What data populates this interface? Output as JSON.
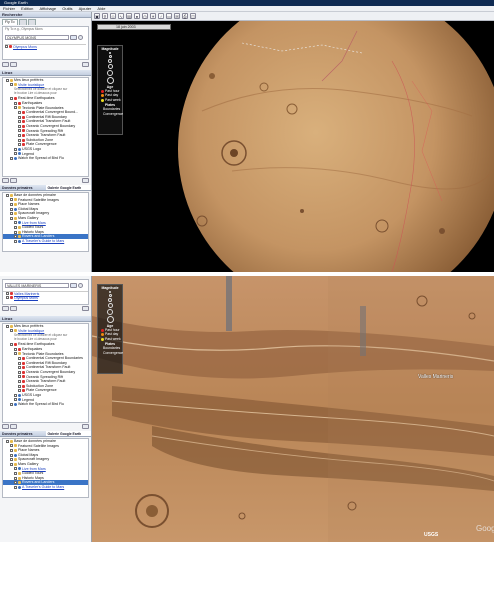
{
  "app": {
    "title": "Google Earth"
  },
  "menu": [
    "Fichier",
    "Edition",
    "Affichage",
    "Outils",
    "Ajouter",
    "Aide"
  ],
  "top": {
    "search_header": "Recherche",
    "search_tabs": [
      "Fly To",
      "",
      ""
    ],
    "fly_to_hint": "Fly To e.g., Olympus Mons",
    "search_value": "OLYMPUS MONS",
    "result": "Olympus Mons",
    "places_header": "Lieux",
    "places": [
      {
        "label": "Mes lieux préférés",
        "indent": 0,
        "icon": "folder"
      },
      {
        "label": "Visite touristique",
        "indent": 1,
        "icon": "folder",
        "link": true
      },
      {
        "label": "Sélectionnez ce dossier et cliquez sur",
        "indent": 2,
        "small": true
      },
      {
        "label": "le bouton Lire ci-dessous pour",
        "indent": 2,
        "small": true
      },
      {
        "label": "Real-time Earthquakes",
        "indent": 1,
        "icon": "red"
      },
      {
        "label": "Earthquakes",
        "indent": 2,
        "icon": "red"
      },
      {
        "label": "Tectonic Plate Boundaries",
        "indent": 2,
        "icon": "folder"
      },
      {
        "label": "Continental Convergent Bound...",
        "indent": 3,
        "icon": "red"
      },
      {
        "label": "Continental Rift Boundary",
        "indent": 3,
        "icon": "red"
      },
      {
        "label": "Continental Transform Fault",
        "indent": 3,
        "icon": "red"
      },
      {
        "label": "Oceanic Convergent Boundary",
        "indent": 3,
        "icon": "red"
      },
      {
        "label": "Oceanic Spreading Rift",
        "indent": 3,
        "icon": "red"
      },
      {
        "label": "Oceanic Transform Fault",
        "indent": 3,
        "icon": "red"
      },
      {
        "label": "Subduction Zone",
        "indent": 3,
        "icon": "red"
      },
      {
        "label": "Plate Convergence",
        "indent": 3,
        "icon": "red"
      },
      {
        "label": "USGS Logo",
        "indent": 2,
        "icon": "globe"
      },
      {
        "label": "Legend",
        "indent": 2,
        "icon": "globe"
      },
      {
        "label": "Watch the Spread of Bird Flu",
        "indent": 1,
        "icon": "globe"
      }
    ],
    "layers_header": "Données primaires",
    "layers_tab": "Galerie Google Earth",
    "layers": [
      {
        "label": "Base de données primaire",
        "indent": 0,
        "icon": "folder"
      },
      {
        "label": "Featured Satellite Images",
        "indent": 1,
        "icon": "folder"
      },
      {
        "label": "Place Names",
        "indent": 1,
        "icon": "folder"
      },
      {
        "label": "Global Maps",
        "indent": 1,
        "icon": "globe"
      },
      {
        "label": "Spacecraft Imagery",
        "indent": 1,
        "icon": "folder"
      },
      {
        "label": "Mars Gallery",
        "indent": 1,
        "icon": "folder"
      },
      {
        "label": "Live from Mars",
        "indent": 2,
        "icon": "globe",
        "link": true
      },
      {
        "label": "Guided Tours",
        "indent": 2,
        "icon": "folder"
      },
      {
        "label": "Historic Maps",
        "indent": 2,
        "icon": "folder"
      },
      {
        "label": "Rovers and Landers",
        "indent": 2,
        "icon": "folder",
        "selected": true
      },
      {
        "label": "A Traveler's Guide to Mars",
        "indent": 2,
        "icon": "globe",
        "link": true
      }
    ],
    "time_label": "18 juin 2003"
  },
  "bottom": {
    "search_value": "VALLES MARINERIS",
    "results": [
      "Valles Marineris",
      "Olympus Mons"
    ],
    "places_header": "Lieux",
    "places": [
      {
        "label": "Mes lieux préférés",
        "indent": 0,
        "icon": "folder"
      },
      {
        "label": "Visite touristique",
        "indent": 1,
        "icon": "folder",
        "link": true
      },
      {
        "label": "Sélectionnez ce dossier et cliquez sur",
        "indent": 2,
        "small": true
      },
      {
        "label": "le bouton Lire ci-dessous pour",
        "indent": 2,
        "small": true
      },
      {
        "label": "Real-time Earthquakes",
        "indent": 1,
        "icon": "red"
      },
      {
        "label": "Earthquakes",
        "indent": 2,
        "icon": "red"
      },
      {
        "label": "Tectonic Plate Boundaries",
        "indent": 2,
        "icon": "folder"
      },
      {
        "label": "Continental Convergent Boundaries",
        "indent": 3,
        "icon": "red"
      },
      {
        "label": "Continental Rift Boundary",
        "indent": 3,
        "icon": "red"
      },
      {
        "label": "Continental Transform Fault",
        "indent": 3,
        "icon": "red"
      },
      {
        "label": "Oceanic Convergent Boundary",
        "indent": 3,
        "icon": "red"
      },
      {
        "label": "Oceanic Spreading Rift",
        "indent": 3,
        "icon": "red"
      },
      {
        "label": "Oceanic Transform Fault",
        "indent": 3,
        "icon": "red"
      },
      {
        "label": "Subduction Zone",
        "indent": 3,
        "icon": "red"
      },
      {
        "label": "Plate Convergence",
        "indent": 3,
        "icon": "red"
      },
      {
        "label": "USGS Logo",
        "indent": 2,
        "icon": "globe"
      },
      {
        "label": "Legend",
        "indent": 2,
        "icon": "globe"
      },
      {
        "label": "Watch the Spread of Bird Flu",
        "indent": 1,
        "icon": "globe"
      }
    ],
    "layers_header": "Données primaires",
    "layers_tab": "Galerie Google Earth",
    "layers": [
      {
        "label": "Base de données primaire",
        "indent": 0,
        "icon": "folder"
      },
      {
        "label": "Featured Satellite Images",
        "indent": 1,
        "icon": "folder"
      },
      {
        "label": "Place Names",
        "indent": 1,
        "icon": "folder"
      },
      {
        "label": "Global Maps",
        "indent": 1,
        "icon": "globe"
      },
      {
        "label": "Spacecraft Imagery",
        "indent": 1,
        "icon": "folder"
      },
      {
        "label": "Mars Gallery",
        "indent": 1,
        "icon": "folder"
      },
      {
        "label": "Live from Mars",
        "indent": 2,
        "icon": "globe",
        "link": true
      },
      {
        "label": "Guided Tours",
        "indent": 2,
        "icon": "folder"
      },
      {
        "label": "Historic Maps",
        "indent": 2,
        "icon": "folder"
      },
      {
        "label": "Rovers and Landers",
        "indent": 2,
        "icon": "folder",
        "selected": true
      },
      {
        "label": "A Traveler's Guide to Mars",
        "indent": 2,
        "icon": "globe",
        "link": true
      }
    ],
    "map_label": "Valles Marineris",
    "usgs_label": "USGS",
    "google_label": "Goog"
  },
  "legend": {
    "magnitude_title": "Magnitude",
    "age_title": "Age",
    "age_items": [
      {
        "label": "Past hour",
        "color": "#e02020"
      },
      {
        "label": "Past day",
        "color": "#f08a10"
      },
      {
        "label": "Past week",
        "color": "#f0e020"
      }
    ],
    "plates_title": "Plates",
    "plates_items": [
      "Boundaries",
      "Convergence"
    ]
  },
  "colors": {
    "accent": "#3a74c6",
    "mars_surface": "#c89a64"
  }
}
